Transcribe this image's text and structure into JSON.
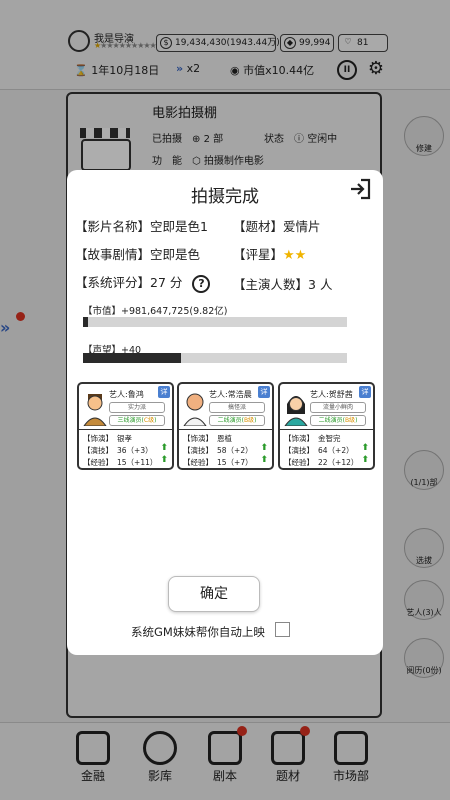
{
  "header": {
    "director_name": "我是导演",
    "director_stars": "★★★★★★★★★★",
    "money": "19,434,430(1943.44万)",
    "diamonds": "99,994",
    "hearts": "81",
    "date": "1年10月18日",
    "speed": "x2",
    "market_value": "市值x10.44亿"
  },
  "studio": {
    "title": "电影拍摄棚",
    "shot_label": "已拍摄",
    "shot_count": "2 部",
    "status_label": "状态",
    "status_value": "空闲中",
    "function_label": "功　能",
    "function_value": "拍摄制作电影"
  },
  "side_right": {
    "build": "修建",
    "count": "(1/1)部",
    "select": "选拔",
    "artists": "艺人(3)人",
    "review": "阅历(0份)"
  },
  "modal": {
    "title": "拍摄完成",
    "film_name_label": "【影片名称】",
    "film_name": "空即是色1",
    "genre_label": "【题材】",
    "genre": "爱情片",
    "plot_label": "【故事剧情】",
    "plot": "空即是色",
    "rating_label": "【评星】",
    "rating_stars": "★★",
    "score_label": "【系统评分】",
    "score": "27 分",
    "lead_label": "【主演人数】",
    "lead_count": "3 人",
    "market_bar_label": "【市值】+981,647,725(9.82亿)",
    "market_bar_fraction": 0.02,
    "fame_bar_label": "【声望】+40",
    "fame_bar_fraction": 0.37,
    "confirm": "确定",
    "auto_release": "系统GM妹妹帮你自动上映"
  },
  "actors": [
    {
      "name": "艺人:鲁鸿",
      "trait": "实力派",
      "tier": "三线演员(",
      "tier_grade": "C级",
      "tier_end": ")",
      "role_label": "【饰演】",
      "role": "银孝",
      "acting_label": "【演技】",
      "acting": "36（+3）",
      "exp_label": "【经验】",
      "exp": "15（+11）"
    },
    {
      "name": "艺人:常浩晨",
      "trait": "搞怪派",
      "tier": "二线演员(",
      "tier_grade": "B级",
      "tier_end": ")",
      "role_label": "【饰演】",
      "role": "恩植",
      "acting_label": "【演技】",
      "acting": "58（+2）",
      "exp_label": "【经验】",
      "exp": "15（+7）"
    },
    {
      "name": "艺人:贺舒茜",
      "trait": "流量小鲜肉",
      "tier": "二线演员(",
      "tier_grade": "B级",
      "tier_end": ")",
      "role_label": "【饰演】",
      "role": "金智完",
      "acting_label": "【演技】",
      "acting": "64（+2）",
      "exp_label": "【经验】",
      "exp": "22（+12）"
    }
  ],
  "nav": [
    {
      "label": "金融",
      "icon": "bank-icon"
    },
    {
      "label": "影库",
      "icon": "film-reel-icon"
    },
    {
      "label": "剧本",
      "icon": "script-icon"
    },
    {
      "label": "题材",
      "icon": "clapperboard-icon"
    },
    {
      "label": "市场部",
      "icon": "chart-screen-icon"
    }
  ],
  "colors": {
    "accent_blue": "#3a67c4",
    "star_gold": "#f0b400",
    "up_green": "#2a9a2a",
    "badge_red": "#d33322"
  }
}
